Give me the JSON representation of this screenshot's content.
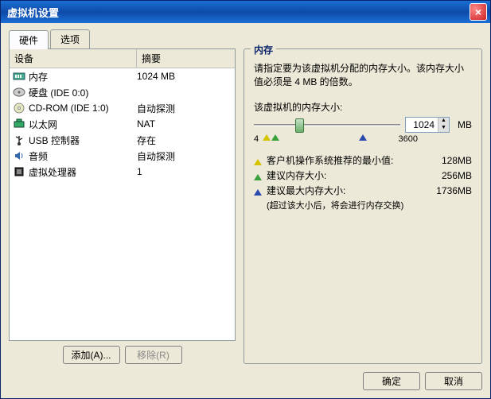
{
  "title": "虚拟机设置",
  "tabs": {
    "hardware": "硬件",
    "options": "选项"
  },
  "device_header": {
    "device": "设备",
    "summary": "摘要"
  },
  "devices": [
    {
      "id": "memory",
      "label": "内存",
      "summary": "1024 MB"
    },
    {
      "id": "hdd",
      "label": "硬盘 (IDE 0:0)",
      "summary": ""
    },
    {
      "id": "cdrom",
      "label": "CD-ROM (IDE 1:0)",
      "summary": "自动探测"
    },
    {
      "id": "eth",
      "label": "以太网",
      "summary": "NAT"
    },
    {
      "id": "usb",
      "label": "USB 控制器",
      "summary": "存在"
    },
    {
      "id": "audio",
      "label": "音频",
      "summary": "自动探测"
    },
    {
      "id": "vcpu",
      "label": "虚拟处理器",
      "summary": "1"
    }
  ],
  "buttons": {
    "add": "添加(A)...",
    "remove": "移除(R)",
    "ok": "确定",
    "cancel": "取消"
  },
  "memory_panel": {
    "group_title": "内存",
    "description": "请指定要为该虚拟机分配的内存大小。该内存大小值必须是 4 MB 的倍数。",
    "size_label": "该虚拟机的内存大小:",
    "value": "1024",
    "unit": "MB",
    "slider": {
      "min_label": "4",
      "max_label": "3600",
      "min": 4,
      "max": 3600,
      "thumb_pos_pct": 28
    },
    "markers": {
      "yellow_pos_pct": 4,
      "green_pos_pct": 8,
      "blue_pos_pct": 48
    },
    "recommendations": [
      {
        "color": "yellow",
        "text": "客户机操作系统推荐的最小值:",
        "value": "128MB"
      },
      {
        "color": "green",
        "text": "建议内存大小:",
        "value": "256MB"
      },
      {
        "color": "blue",
        "text": "建议最大内存大小:",
        "value": "1736MB"
      }
    ],
    "note": "(超过该大小后，将会进行内存交换)"
  }
}
